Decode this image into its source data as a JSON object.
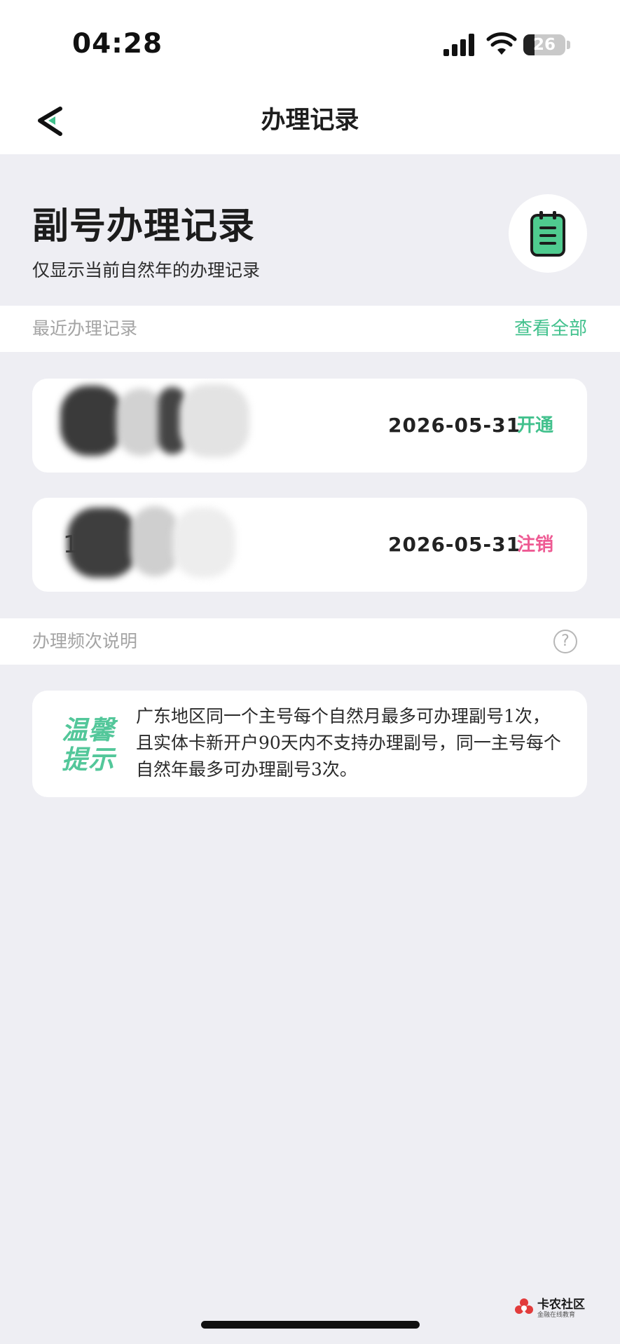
{
  "status_bar": {
    "time": "04:28",
    "battery": "26",
    "battery_level": 0.26
  },
  "nav": {
    "title": "办理记录"
  },
  "header": {
    "title": "副号办理记录",
    "subtitle": "仅显示当前自然年的办理记录",
    "icon": "notepad-icon"
  },
  "recent_section": {
    "label": "最近办理记录",
    "view_all": "查看全部"
  },
  "records": [
    {
      "number_visible": "",
      "date": "2026-05-31",
      "status": "开通",
      "status_color": "#42c18d"
    },
    {
      "number_visible": "1",
      "date": "2026-05-31",
      "status": "注销",
      "status_color": "#ee5a93"
    }
  ],
  "frequency_section": {
    "label": "办理频次说明",
    "help_icon": "?"
  },
  "tip": {
    "badge": "温馨提示",
    "text": "广东地区同一个主号每个自然月最多可办理副号1次，且实体卡新开户90天内不支持办理副号，同一主号每个自然年最多可办理副号3次。"
  },
  "watermark": {
    "name": "卡农社区",
    "slogan": "金融在线教育"
  },
  "colors": {
    "accent_green": "#42c18d",
    "cancel_pink": "#ee5a93",
    "page_bg": "#eeeef3"
  }
}
